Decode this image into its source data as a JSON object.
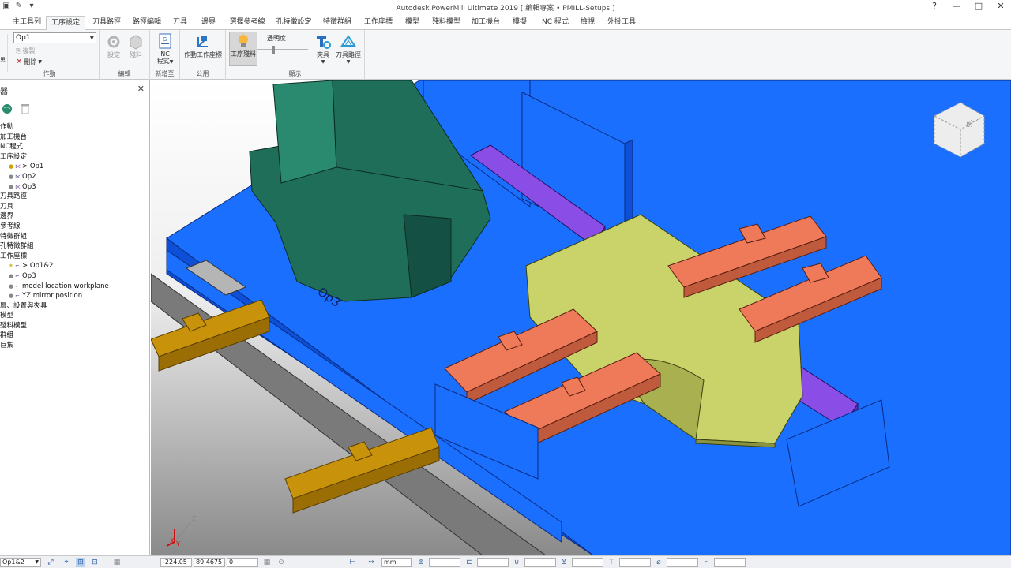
{
  "window": {
    "title": "Autodesk PowerMill Ultimate 2019   [ 編輯專案 • PMILL-Setups ]"
  },
  "tabs": [
    "主工具列",
    "工序設定",
    "刀具路徑",
    "路徑編輯",
    "刀具",
    "邊界",
    "選擇參考線",
    "孔特徵設定",
    "特徵群組",
    "工作座標",
    "模型",
    "殘料模型",
    "加工機台",
    "模擬",
    "NC 程式",
    "檢視",
    "外掛工具"
  ],
  "active_tab": "工序設定",
  "ribbon": {
    "setup_combo_value": "Op1",
    "copy_label": "複製",
    "delete_label": "刪除",
    "group_action": "作動",
    "settings_label": "設定",
    "stock_label": "殘料",
    "group_edit": "編輯",
    "nc_label_1": "NC",
    "nc_label_2": "程式",
    "group_add": "新增至",
    "workplane_label": "作動工作座標",
    "group_common": "公用",
    "setup_stock_label": "工序殘料",
    "transparency_label": "透明度",
    "fixture_label": "夾具",
    "toolpath_label": "刀具路徑",
    "group_display": "顯示"
  },
  "explorer": {
    "title": "器",
    "items": [
      {
        "label": "作動",
        "level": 0
      },
      {
        "label": "加工機台",
        "level": 0
      },
      {
        "label": "NC程式",
        "level": 0
      },
      {
        "label": "工序設定",
        "level": 0
      },
      {
        "label": "> Op1",
        "level": 1
      },
      {
        "label": "Op2",
        "level": 1
      },
      {
        "label": "Op3",
        "level": 1
      },
      {
        "label": "刀具路徑",
        "level": 0
      },
      {
        "label": "刀具",
        "level": 0
      },
      {
        "label": "邊界",
        "level": 0
      },
      {
        "label": "參考線",
        "level": 0
      },
      {
        "label": "特徵群組",
        "level": 0
      },
      {
        "label": "孔特徵群組",
        "level": 0
      },
      {
        "label": "工作座標",
        "level": 0
      },
      {
        "label": "> Op1&2",
        "level": 1
      },
      {
        "label": "Op3",
        "level": 1
      },
      {
        "label": "model location workplane",
        "level": 1
      },
      {
        "label": "YZ mirror position",
        "level": 1
      },
      {
        "label": "層、設置與夾具",
        "level": 0
      },
      {
        "label": "模型",
        "level": 0
      },
      {
        "label": "殘料模型",
        "level": 0
      },
      {
        "label": "群組",
        "level": 0
      },
      {
        "label": "巨集",
        "level": 0
      }
    ]
  },
  "viewport": {
    "op_label": "Op3",
    "viewcube_label": "前",
    "axis_x": "X",
    "axis_y": "Y",
    "axis_z": "Z"
  },
  "statusbar": {
    "workplane": "Op1&2",
    "x": "-224.05",
    "y": "89.4675",
    "z": "0",
    "units": "mm"
  },
  "colors": {
    "table_blue": "#1a6fff",
    "part_green": "#1e6e5a",
    "part_yellow": "#c9d36a",
    "clamp_orange": "#ef7a5a",
    "clamp_purple": "#8a4ee6",
    "rail_gold": "#c8920a"
  }
}
